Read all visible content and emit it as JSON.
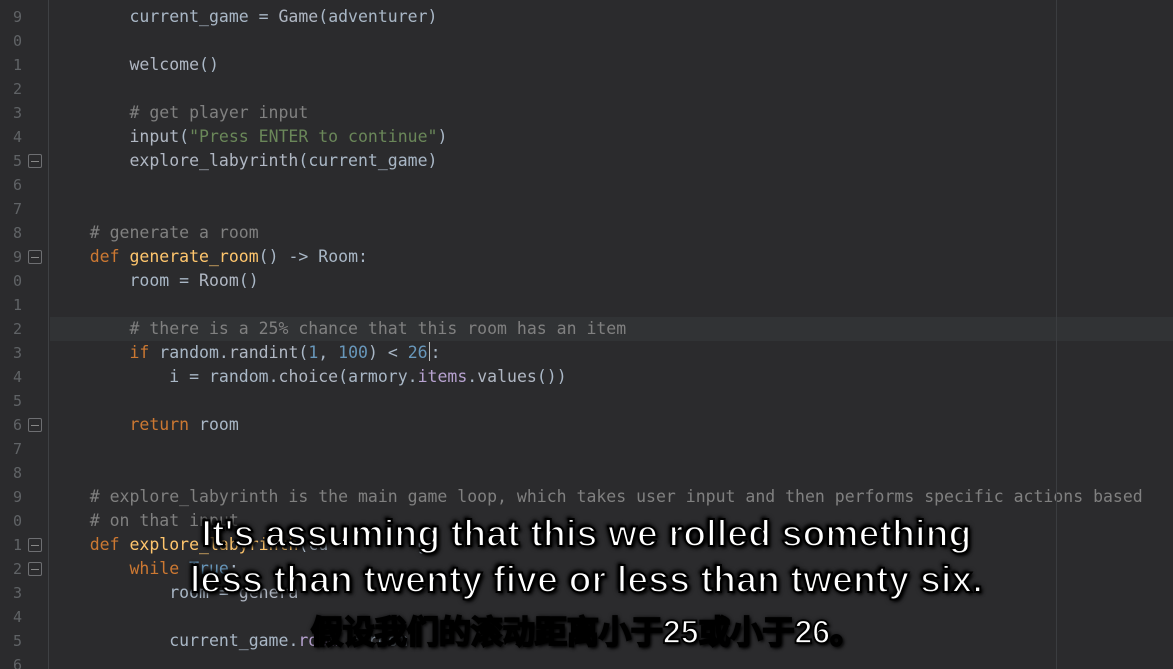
{
  "gutter": [
    "9",
    "0",
    "1",
    "2",
    "3",
    "4",
    "5",
    "6",
    "7",
    "8",
    "9",
    "0",
    "1",
    "2",
    "3",
    "4",
    "5",
    "6",
    "7",
    "8",
    "9",
    "0",
    "1",
    "2",
    "3",
    "4",
    "5",
    "6"
  ],
  "fold_markers": [
    {
      "row_index": 6
    },
    {
      "row_index": 10
    },
    {
      "row_index": 17
    },
    {
      "row_index": 22
    },
    {
      "row_index": 23
    }
  ],
  "highlighted_row_index": 13,
  "lines": [
    {
      "indent": "        ",
      "tokens": [
        [
          "c-id",
          "current_game "
        ],
        [
          "c-op",
          "= "
        ],
        [
          "c-call",
          "Game"
        ],
        [
          "c-par",
          "("
        ],
        [
          "c-id",
          "adventurer"
        ],
        [
          "c-par",
          ")"
        ]
      ]
    },
    {
      "indent": "",
      "tokens": []
    },
    {
      "indent": "        ",
      "tokens": [
        [
          "c-call",
          "welcome"
        ],
        [
          "c-par",
          "()"
        ]
      ]
    },
    {
      "indent": "",
      "tokens": []
    },
    {
      "indent": "        ",
      "tokens": [
        [
          "c-cmt",
          "# get player input"
        ]
      ]
    },
    {
      "indent": "        ",
      "tokens": [
        [
          "c-call",
          "input"
        ],
        [
          "c-par",
          "("
        ],
        [
          "c-str",
          "\"Press ENTER to continue\""
        ],
        [
          "c-par",
          ")"
        ]
      ]
    },
    {
      "indent": "        ",
      "tokens": [
        [
          "c-call",
          "explore_labyrinth"
        ],
        [
          "c-par",
          "("
        ],
        [
          "c-id",
          "current_game"
        ],
        [
          "c-par",
          ")"
        ]
      ]
    },
    {
      "indent": "",
      "tokens": []
    },
    {
      "indent": "",
      "tokens": []
    },
    {
      "indent": "    ",
      "tokens": [
        [
          "c-cmt",
          "# generate a room"
        ]
      ]
    },
    {
      "indent": "    ",
      "tokens": [
        [
          "c-key",
          "def "
        ],
        [
          "c-name",
          "generate_room"
        ],
        [
          "c-par",
          "()"
        ],
        [
          "c-op",
          " -> "
        ],
        [
          "c-type",
          "Room:"
        ]
      ]
    },
    {
      "indent": "        ",
      "tokens": [
        [
          "c-id",
          "room "
        ],
        [
          "c-op",
          "= "
        ],
        [
          "c-call",
          "Room"
        ],
        [
          "c-par",
          "()"
        ]
      ]
    },
    {
      "indent": "",
      "tokens": []
    },
    {
      "indent": "        ",
      "tokens": [
        [
          "c-cmt",
          "# there is a 25% chance that this room has an item"
        ]
      ]
    },
    {
      "indent": "        ",
      "tokens": [
        [
          "c-key",
          "if "
        ],
        [
          "c-id",
          "random"
        ],
        [
          "c-op",
          "."
        ],
        [
          "c-call",
          "randint"
        ],
        [
          "c-par",
          "("
        ],
        [
          "c-num",
          "1"
        ],
        [
          "c-op",
          ", "
        ],
        [
          "c-num",
          "100"
        ],
        [
          "c-par",
          ")"
        ],
        [
          "c-op",
          " < "
        ],
        [
          "c-num",
          "26"
        ],
        [
          "caret",
          ""
        ],
        [
          "c-op",
          ":"
        ]
      ]
    },
    {
      "indent": "            ",
      "tokens": [
        [
          "c-id",
          "i "
        ],
        [
          "c-op",
          "= "
        ],
        [
          "c-id",
          "random"
        ],
        [
          "c-op",
          "."
        ],
        [
          "c-call",
          "choice"
        ],
        [
          "c-par",
          "("
        ],
        [
          "c-id",
          "armory"
        ],
        [
          "c-op",
          "."
        ],
        [
          "c-attr",
          "items"
        ],
        [
          "c-op",
          "."
        ],
        [
          "c-call",
          "values"
        ],
        [
          "c-par",
          "())"
        ]
      ]
    },
    {
      "indent": "",
      "tokens": []
    },
    {
      "indent": "        ",
      "tokens": [
        [
          "c-key",
          "return "
        ],
        [
          "c-id",
          "room"
        ]
      ]
    },
    {
      "indent": "",
      "tokens": []
    },
    {
      "indent": "",
      "tokens": []
    },
    {
      "indent": "    ",
      "tokens": [
        [
          "c-cmt",
          "# explore_labyrinth is the main game loop, which takes user input and then performs specific actions based"
        ]
      ]
    },
    {
      "indent": "    ",
      "tokens": [
        [
          "c-cmt",
          "# on that input"
        ]
      ]
    },
    {
      "indent": "    ",
      "tokens": [
        [
          "c-key",
          "def "
        ],
        [
          "c-name",
          "explore_labyrinth"
        ],
        [
          "c-par",
          "("
        ],
        [
          "c-id",
          "cu"
        ],
        [
          "c-id",
          "         g"
        ]
      ]
    },
    {
      "indent": "        ",
      "tokens": [
        [
          "c-key",
          "while "
        ],
        [
          "c-num",
          "True"
        ],
        [
          "c-op",
          ":"
        ]
      ]
    },
    {
      "indent": "            ",
      "tokens": [
        [
          "c-id",
          "room "
        ],
        [
          "c-op",
          "= "
        ],
        [
          "c-call",
          "genera"
        ]
      ]
    },
    {
      "indent": "",
      "tokens": []
    },
    {
      "indent": "            ",
      "tokens": [
        [
          "c-id",
          "current_game"
        ],
        [
          "c-op",
          "."
        ],
        [
          "c-attr",
          "room"
        ],
        [
          "c-op",
          " = "
        ],
        [
          "c-id",
          "room"
        ]
      ]
    },
    {
      "indent": "",
      "tokens": []
    }
  ],
  "subtitle_en_line1": "It's assuming that this we rolled something",
  "subtitle_en_line2": "less than twenty five or less than twenty six.",
  "subtitle_zh": "假设我们的滚动距离小于25或小于26。"
}
